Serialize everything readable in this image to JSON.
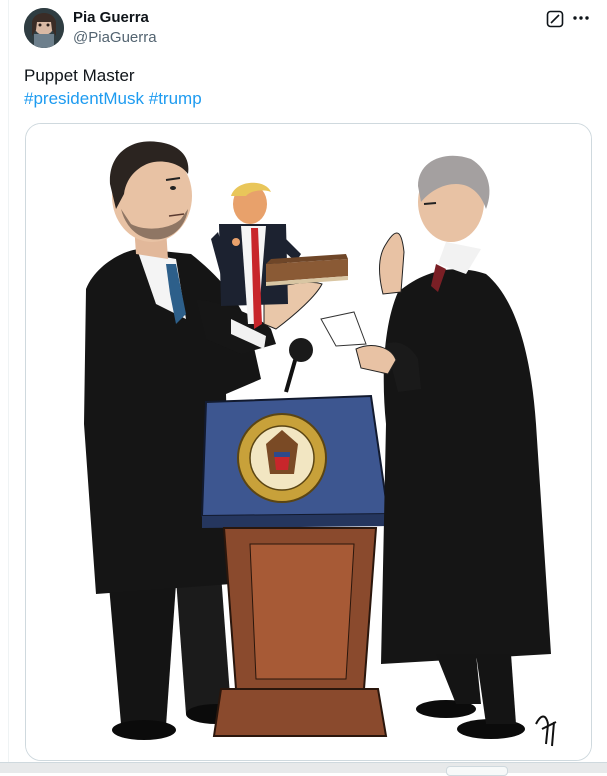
{
  "tweet": {
    "author": {
      "display_name": "Pia Guerra",
      "handle": "@PiaGuerra",
      "avatar_icon": "avatar-photo"
    },
    "actions": {
      "grok_icon": "grok-icon",
      "more_icon": "more-dots-icon"
    },
    "text": "Puppet Master",
    "hashtags": [
      "#presidentMusk",
      "#trump"
    ],
    "media": {
      "type": "illustration",
      "seal_text": "SEAL OF THE PRESIDENT OF THE UNITED STATES"
    }
  },
  "colors": {
    "link": "#1d9bf0",
    "text_primary": "#0f1419",
    "text_secondary": "#536471",
    "border": "#cfd9de",
    "podium_blue": "#3d5690",
    "podium_wood": "#8a4a2d",
    "seal_gold": "#c8a13a",
    "tie_blue": "#2d5f8a",
    "robe_black": "#151515"
  }
}
